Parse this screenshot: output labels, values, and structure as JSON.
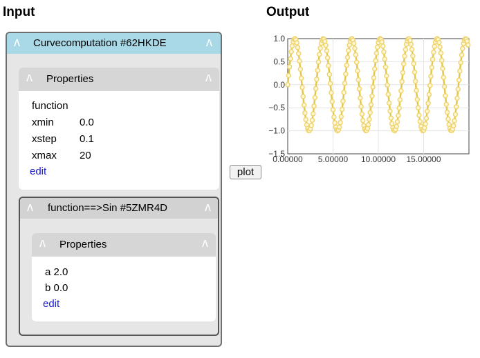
{
  "headers": {
    "input": "Input",
    "output": "Output"
  },
  "outer": {
    "title": "Curvecomputation #62HKDE"
  },
  "properties1": {
    "title": "Properties",
    "function_label": "function",
    "rows": [
      {
        "key": "xmin",
        "value": "0.0"
      },
      {
        "key": "xstep",
        "value": "0.1"
      },
      {
        "key": "xmax",
        "value": "20"
      }
    ],
    "edit": "edit"
  },
  "inner": {
    "title": "function==>Sin #5ZMR4D"
  },
  "properties2": {
    "title": "Properties",
    "rows": [
      "a 2.0",
      "b 0.0"
    ],
    "edit": "edit"
  },
  "caret": "ʌ",
  "plot_button": "plot",
  "chart_data": {
    "type": "line",
    "function": "sin(2x)",
    "x_start": 0.0,
    "x_step": 0.1,
    "x_end": 20,
    "xlim": [
      0,
      20
    ],
    "ylim": [
      -1.5,
      1.0
    ],
    "xticks": [
      "0.00000",
      "5.00000",
      "10.00000",
      "15.00000"
    ],
    "yticks": [
      "1.0",
      "0.5",
      "0.0",
      "−0.5",
      "−1.0",
      "−1.5"
    ],
    "line_color": "#e3c74c",
    "marker_color": "#efd470",
    "grid": true
  }
}
